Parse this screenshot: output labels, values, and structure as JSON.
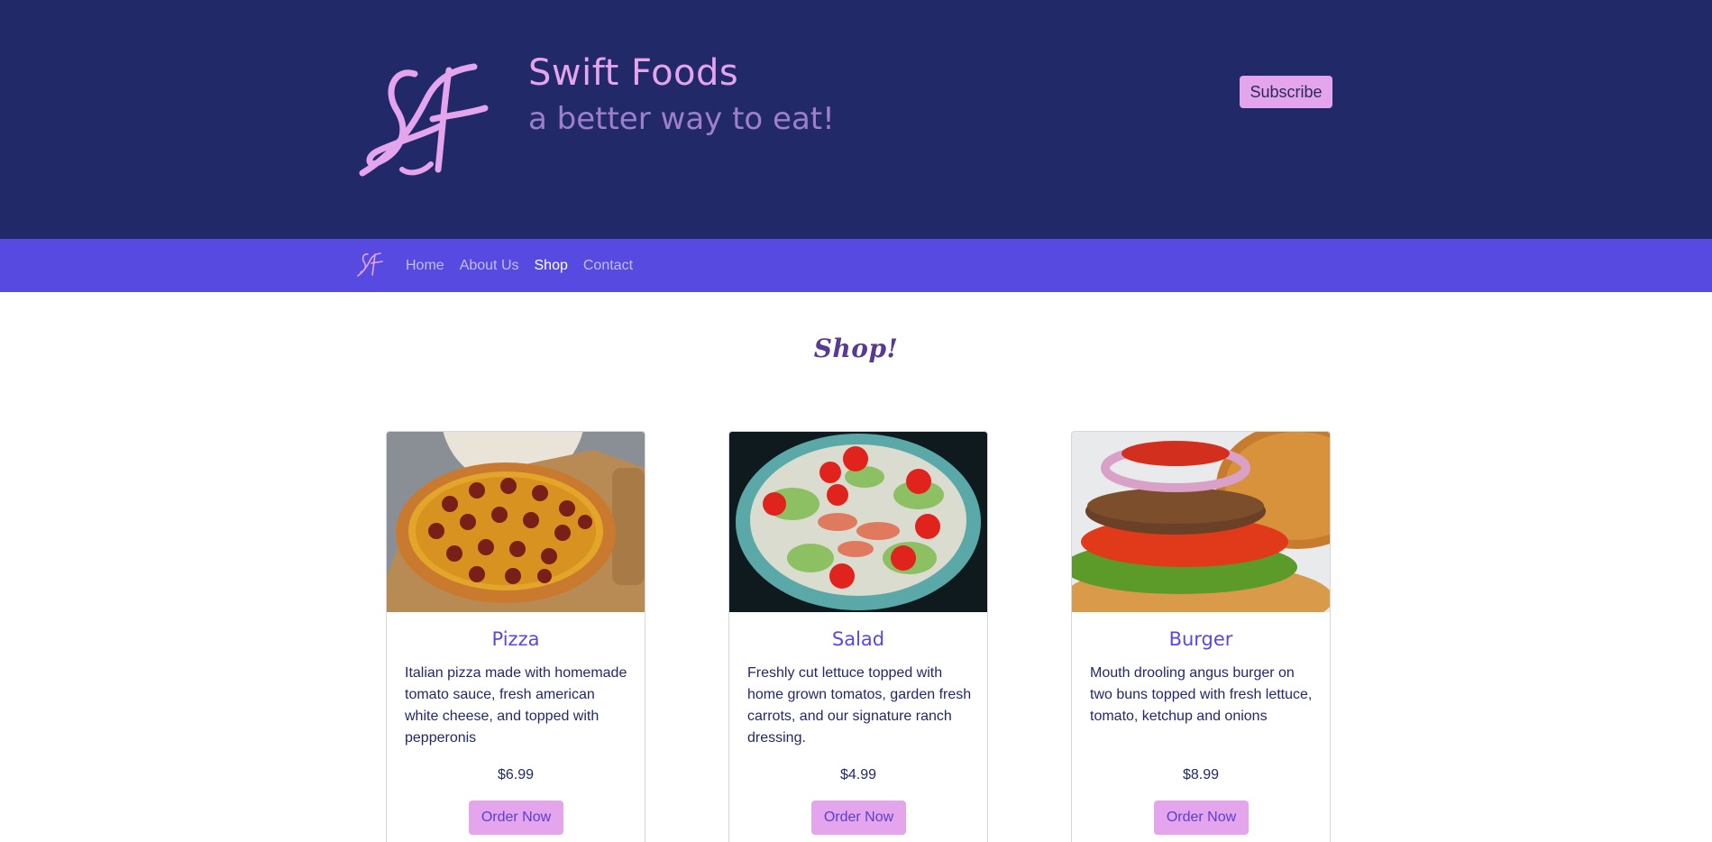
{
  "header": {
    "logo_icon": "sf-monogram-logo",
    "title": "Swift Foods",
    "tagline": "a better way to eat!",
    "subscribe_label": "Subscribe"
  },
  "nav": {
    "logo_icon": "sf-monogram-small-logo",
    "items": [
      {
        "label": "Home",
        "active": false
      },
      {
        "label": "About Us",
        "active": false
      },
      {
        "label": "Shop",
        "active": true
      },
      {
        "label": "Contact",
        "active": false
      }
    ]
  },
  "shop": {
    "title": "Shop!",
    "products": [
      {
        "name": "Pizza",
        "image": "pepperoni-pizza-photo",
        "description": "Italian pizza made with homemade tomato sauce, fresh american white cheese, and topped with pepperonis",
        "price": "$6.99",
        "button_label": "Order Now"
      },
      {
        "name": "Salad",
        "image": "salad-bowl-photo",
        "description": "Freshly cut lettuce topped with home grown tomatos, garden fresh carrots, and our signature ranch dressing.",
        "price": "$4.99",
        "button_label": "Order Now"
      },
      {
        "name": "Burger",
        "image": "burger-photo",
        "description": "Mouth drooling angus burger on two buns topped with fresh lettuce, tomato, ketchup and onions",
        "price": "$8.99",
        "button_label": "Order Now"
      }
    ]
  },
  "colors": {
    "header_bg": "#222969",
    "nav_bg": "#564ae0",
    "accent_pink": "#e4a5ec",
    "tagline": "#9d7fcd",
    "card_title": "#564ae0",
    "text_dark": "#22296b"
  }
}
